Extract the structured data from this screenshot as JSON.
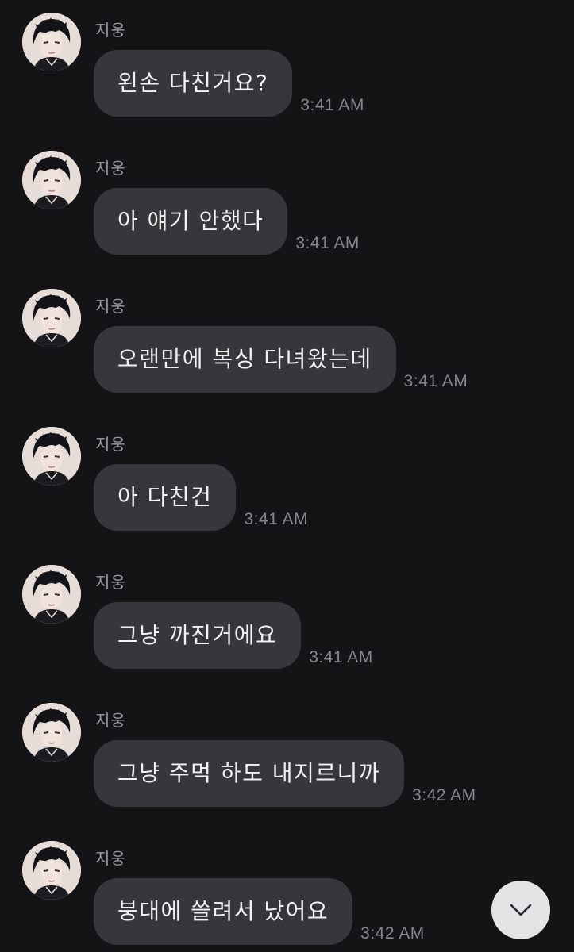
{
  "messages": [
    {
      "sender": "지웅",
      "text": "왼손 다친거요?",
      "time": "3:41 AM"
    },
    {
      "sender": "지웅",
      "text": "아 얘기 안했다",
      "time": "3:41 AM"
    },
    {
      "sender": "지웅",
      "text": "오랜만에 복싱 다녀왔는데",
      "time": "3:41 AM"
    },
    {
      "sender": "지웅",
      "text": "아 다친건",
      "time": "3:41 AM"
    },
    {
      "sender": "지웅",
      "text": "그냥 까진거에요",
      "time": "3:41 AM"
    },
    {
      "sender": "지웅",
      "text": "그냥 주먹 하도 내지르니까",
      "time": "3:42 AM"
    },
    {
      "sender": "지웅",
      "text": "붕대에 쓸려서 났어요",
      "time": "3:42 AM"
    }
  ],
  "scroll_button": {
    "icon": "chevron-down-icon"
  },
  "colors": {
    "background": "#141417",
    "bubble": "#36363b",
    "message_text": "#f2f2f2",
    "sender_text": "#9a9aa0",
    "time_text": "#86868c",
    "scroll_button": "#e4e4e7"
  }
}
